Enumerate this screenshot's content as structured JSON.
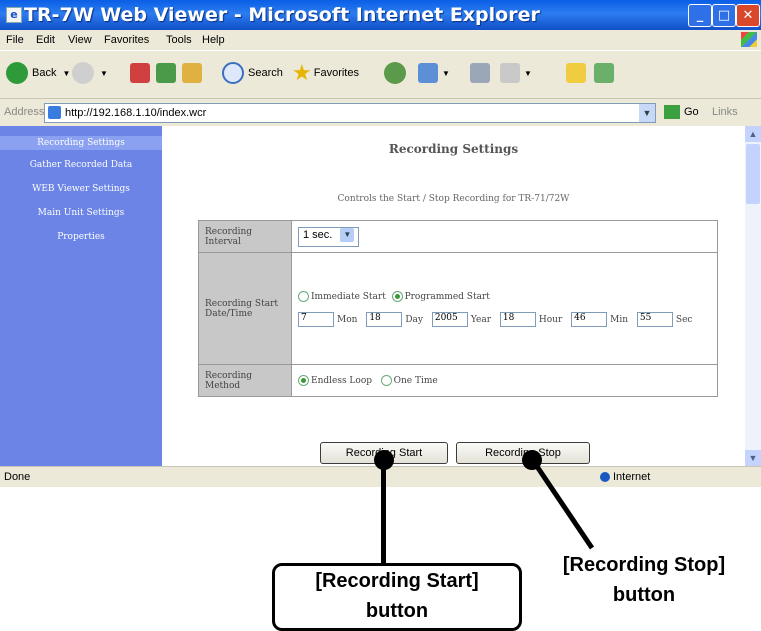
{
  "window": {
    "title": "TR-7W Web Viewer - Microsoft Internet Explorer",
    "menu": [
      "File",
      "Edit",
      "View",
      "Favorites",
      "Tools",
      "Help"
    ],
    "toolbar": {
      "back": "Back",
      "search": "Search",
      "favorites": "Favorites"
    },
    "address": {
      "label": "Address",
      "url": "http://192.168.1.10/index.wcr",
      "go": "Go",
      "links": "Links"
    },
    "status": {
      "left": "Done",
      "zone": "Internet"
    }
  },
  "sidebar": {
    "items": [
      "Recording Settings",
      "Gather Recorded Data",
      "WEB Viewer Settings",
      "Main Unit Settings",
      "Properties"
    ]
  },
  "page": {
    "heading": "Recording Settings",
    "subtitle": "Controls the Start / Stop Recording for TR-71/72W",
    "interval_label": "Recording Interval",
    "interval_value": "1 sec.",
    "start_label": "Recording Start Date/Time",
    "opt_immediate": "Immediate Start",
    "opt_programmed": "Programmed Start",
    "fields": [
      {
        "value": "7",
        "unit": "Mon"
      },
      {
        "value": "18",
        "unit": "Day"
      },
      {
        "value": "2005",
        "unit": "Year"
      },
      {
        "value": "18",
        "unit": "Hour"
      },
      {
        "value": "46",
        "unit": "Min"
      },
      {
        "value": "55",
        "unit": "Sec"
      }
    ],
    "method_label": "Recording Method",
    "opt_endless": "Endless Loop",
    "opt_onetime": "One Time",
    "btn_start": "Recording Start",
    "btn_stop": "Recording Stop"
  },
  "annotations": {
    "start_line1": "[Recording Start]",
    "start_line2": "button",
    "stop_line1": "[Recording Stop]",
    "stop_line2": "button"
  }
}
